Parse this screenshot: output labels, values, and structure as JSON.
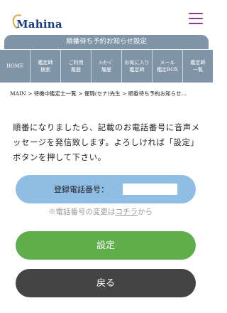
{
  "header": {
    "logo_text": "Mahina"
  },
  "banner": {
    "title": "順番待ち予約お知らせ設定"
  },
  "nav": [
    {
      "label": "HOME",
      "icon": "home-icon"
    },
    {
      "label": "鑑定師\n検索"
    },
    {
      "label": "ご利用\n履歴"
    },
    {
      "label": "ﾒｯｾｰｼﾞ\n履歴"
    },
    {
      "label": "お気に入り\n鑑定師"
    },
    {
      "label": "メール\n鑑定BOX"
    },
    {
      "label": "鑑定師\n一覧"
    }
  ],
  "breadcrumb": {
    "text": "MAIN > 待機中鑑定士一覧 > 惺璐(セナ)先生 > 順番待ち予約お知らせ…"
  },
  "message": {
    "text": "順番になりましたら、記載のお電話番号に音声メッセージを発信致します。よろしければ「設定」ボタンを押して下さい。"
  },
  "phone": {
    "label": "登録電話番号：",
    "value": ""
  },
  "note": {
    "prefix": "※電話番号の変更は",
    "link": "コチラ",
    "suffix": "から"
  },
  "buttons": {
    "settings": "設定",
    "back": "戻る"
  },
  "colors": {
    "nav_bg": "#7f95a7",
    "phone_box_bg": "#8fbde4",
    "settings_btn": "#5fae4b",
    "back_btn": "#444444",
    "hamburger": "#8a3c8f",
    "logo_text": "#173a82"
  }
}
